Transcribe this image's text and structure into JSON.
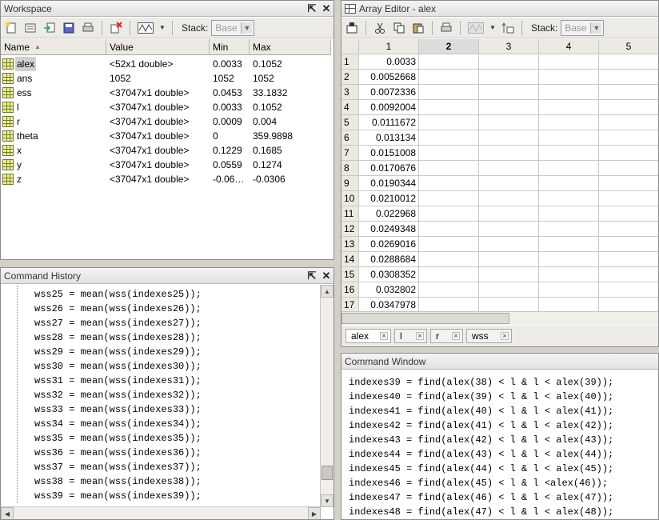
{
  "workspace": {
    "title": "Workspace",
    "pin": "⇱",
    "close": "✕",
    "stack_label": "Stack:",
    "stack_value": "Base",
    "columns": [
      "Name",
      "Value",
      "Min",
      "Max"
    ],
    "sort_indicator": "▲",
    "variables": [
      {
        "name": "alex",
        "value": "<52x1 double>",
        "min": "0.0033",
        "max": "0.1052"
      },
      {
        "name": "ans",
        "value": "1052",
        "min": "1052",
        "max": "1052"
      },
      {
        "name": "ess",
        "value": "<37047x1 double>",
        "min": "0.0453",
        "max": "33.1832"
      },
      {
        "name": "l",
        "value": "<37047x1 double>",
        "min": "0.0033",
        "max": "0.1052"
      },
      {
        "name": "r",
        "value": "<37047x1 double>",
        "min": "0.0009",
        "max": "0.004"
      },
      {
        "name": "theta",
        "value": "<37047x1 double>",
        "min": "0",
        "max": "359.9898"
      },
      {
        "name": "x",
        "value": "<37047x1 double>",
        "min": "0.1229",
        "max": "0.1685"
      },
      {
        "name": "y",
        "value": "<37047x1 double>",
        "min": "0.0559",
        "max": "0.1274"
      },
      {
        "name": "z",
        "value": "<37047x1 double>",
        "min": "-0.06…",
        "max": "-0.0306"
      }
    ]
  },
  "history": {
    "title": "Command History",
    "pin": "⇱",
    "close": "✕",
    "lines": [
      "wss25 = mean(wss(indexes25));",
      "wss26 = mean(wss(indexes26));",
      "wss27 = mean(wss(indexes27));",
      "wss28 = mean(wss(indexes28));",
      "wss29 = mean(wss(indexes29));",
      "wss30 = mean(wss(indexes30));",
      "wss31 = mean(wss(indexes31));",
      "wss32 = mean(wss(indexes32));",
      "wss33 = mean(wss(indexes33));",
      "wss34 = mean(wss(indexes34));",
      "wss35 = mean(wss(indexes35));",
      "wss36 = mean(wss(indexes36));",
      "wss37 = mean(wss(indexes37));",
      "wss38 = mean(wss(indexes38));",
      "wss39 = mean(wss(indexes39));"
    ]
  },
  "array_editor": {
    "title": "Array Editor - alex",
    "stack_label": "Stack:",
    "stack_value": "Base",
    "columns": [
      "1",
      "2",
      "3",
      "4",
      "5"
    ],
    "active_column": "2",
    "rows": [
      {
        "n": "1",
        "v": "0.0033"
      },
      {
        "n": "2",
        "v": "0.0052668"
      },
      {
        "n": "3",
        "v": "0.0072336"
      },
      {
        "n": "4",
        "v": "0.0092004"
      },
      {
        "n": "5",
        "v": "0.0111672"
      },
      {
        "n": "6",
        "v": "0.013134"
      },
      {
        "n": "7",
        "v": "0.0151008"
      },
      {
        "n": "8",
        "v": "0.0170676"
      },
      {
        "n": "9",
        "v": "0.0190344"
      },
      {
        "n": "10",
        "v": "0.0210012"
      },
      {
        "n": "11",
        "v": "0.022968"
      },
      {
        "n": "12",
        "v": "0.0249348"
      },
      {
        "n": "13",
        "v": "0.0269016"
      },
      {
        "n": "14",
        "v": "0.0288684"
      },
      {
        "n": "15",
        "v": "0.0308352"
      },
      {
        "n": "16",
        "v": "0.032802"
      },
      {
        "n": "17",
        "v": "0.0347978"
      }
    ],
    "tabs": [
      "alex",
      "l",
      "r",
      "wss"
    ],
    "tab_close": "×"
  },
  "command_window": {
    "title": "Command Window",
    "lines": [
      "indexes39 = find(alex(38) < l & l < alex(39));",
      "indexes40 = find(alex(39) < l & l < alex(40));",
      "indexes41 = find(alex(40) < l & l < alex(41));",
      "indexes42 = find(alex(41) < l & l < alex(42));",
      "indexes43 = find(alex(42) < l & l < alex(43));",
      "indexes44 = find(alex(43) < l & l < alex(44));",
      "indexes45 = find(alex(44) < l & l < alex(45));",
      "indexes46 = find(alex(45) < l & l <alex(46));",
      "indexes47 = find(alex(46) < l & l < alex(47));",
      "indexes48 = find(alex(47) < l & l < alex(48));"
    ]
  }
}
